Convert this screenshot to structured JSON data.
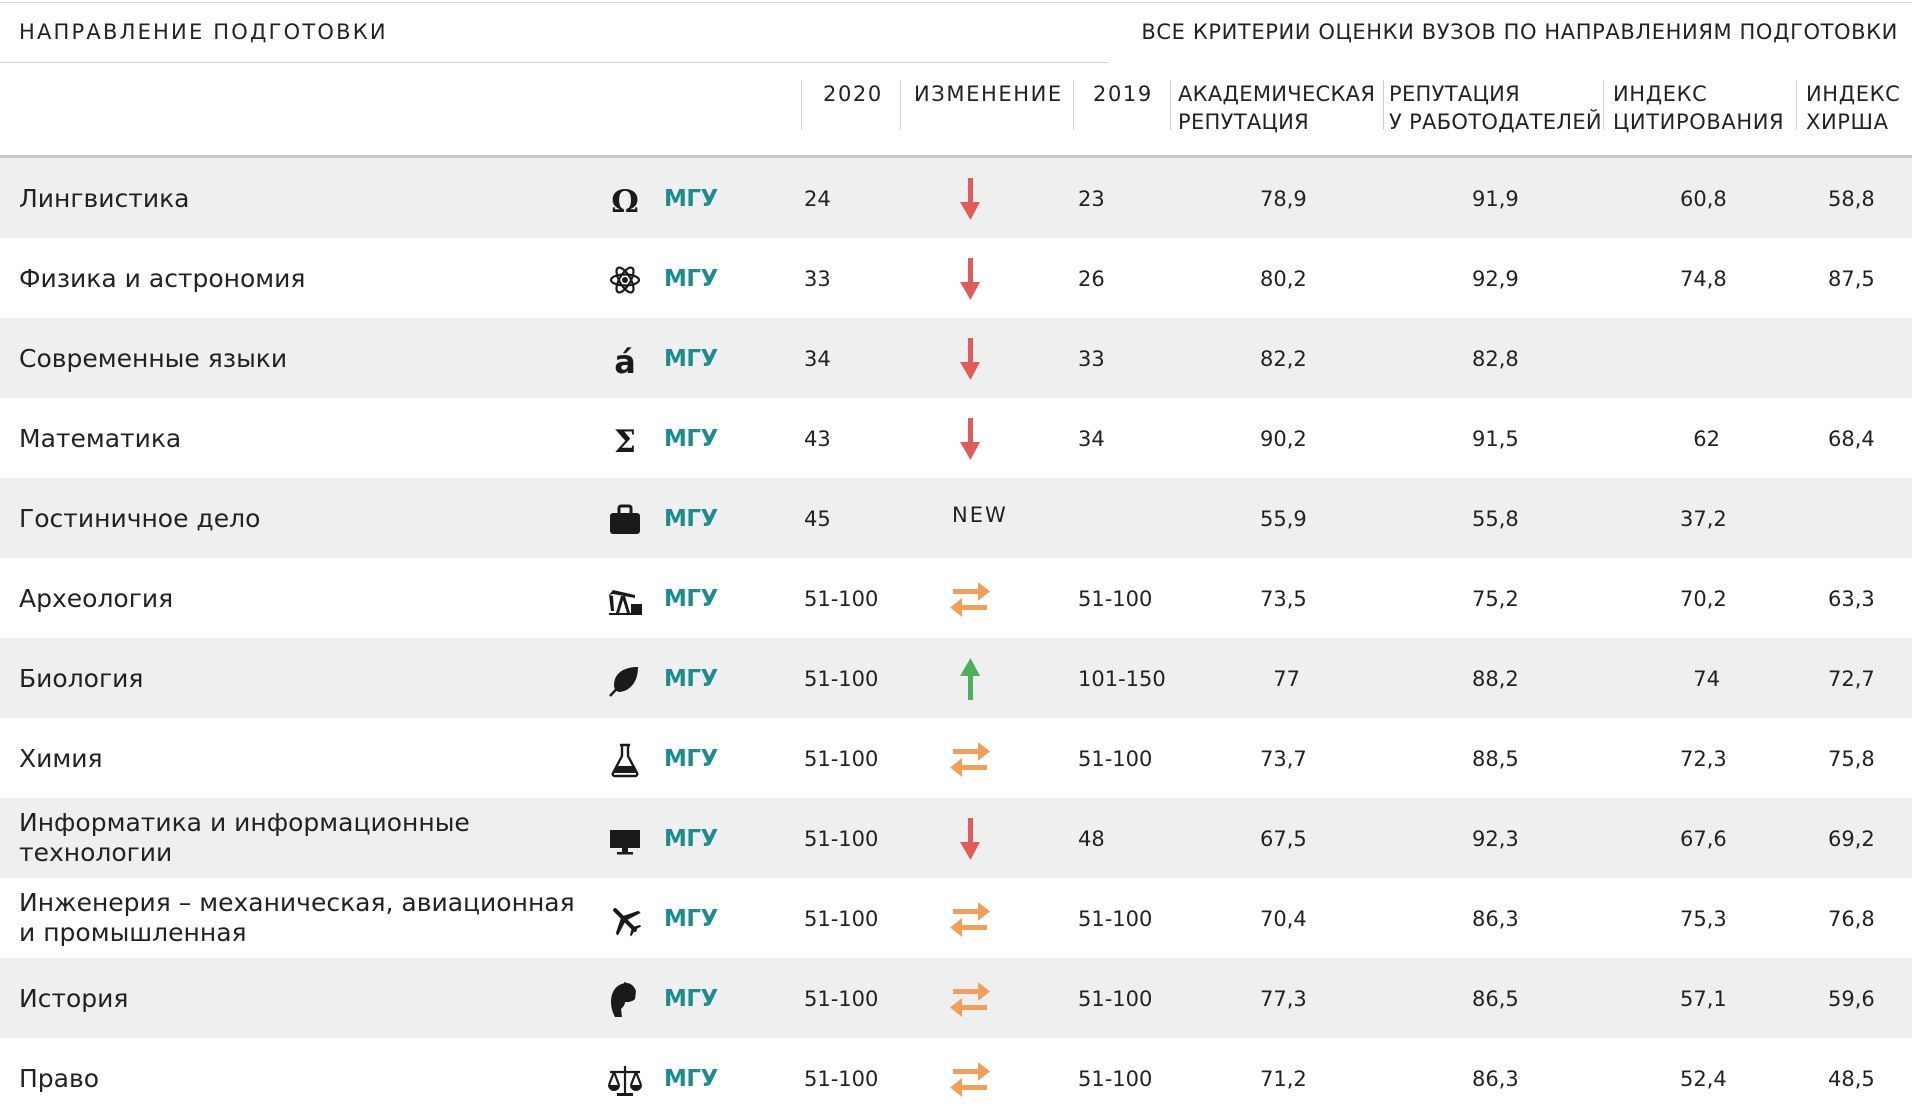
{
  "header": {
    "left_title": "Направление подготовки",
    "right_title": "Все критерии оценки вузов по направлениям подготовки"
  },
  "columns": {
    "y2020": "2020",
    "change": "Изменение",
    "y2019": "2019",
    "academic_1": "Академическая",
    "academic_2": "репутация",
    "employer_1": "Репутация",
    "employer_2": "у работодателей",
    "citation_1": "Индекс",
    "citation_2": "цитирования",
    "hirsch_1": "Индекс",
    "hirsch_2": "Хирша"
  },
  "colors": {
    "down": "#e05b5b",
    "up": "#4fae5e",
    "same": "#f0a05a",
    "university": "#1e8c8e",
    "row_shade": "#efefef"
  },
  "rows": [
    {
      "name": "Лингвистика",
      "icon": "omega-icon",
      "university": "МГУ",
      "y2020": "24",
      "change": "down",
      "y2019": "23",
      "academic": "78,9",
      "employer": "91,9",
      "citation": "60,8",
      "hirsch": "58,8"
    },
    {
      "name": "Физика и астрономия",
      "icon": "atom-icon",
      "university": "МГУ",
      "y2020": "33",
      "change": "down",
      "y2019": "26",
      "academic": "80,2",
      "employer": "92,9",
      "citation": "74,8",
      "hirsch": "87,5"
    },
    {
      "name": "Современные языки",
      "icon": "accent-a-icon",
      "university": "МГУ",
      "y2020": "34",
      "change": "down",
      "y2019": "33",
      "academic": "82,2",
      "employer": "82,8",
      "citation": "",
      "hirsch": ""
    },
    {
      "name": "Математика",
      "icon": "sigma-icon",
      "university": "МГУ",
      "y2020": "43",
      "change": "down",
      "y2019": "34",
      "academic": "90,2",
      "employer": "91,5",
      "citation": "62",
      "hirsch": "68,4"
    },
    {
      "name": "Гостиничное дело",
      "icon": "suitcase-icon",
      "university": "МГУ",
      "y2020": "45",
      "change": "new",
      "change_label": "NEW",
      "y2019": "",
      "academic": "55,9",
      "employer": "55,8",
      "citation": "37,2",
      "hirsch": ""
    },
    {
      "name": "Археология",
      "icon": "oil-pump-icon",
      "university": "МГУ",
      "y2020": "51-100",
      "change": "same",
      "y2019": "51-100",
      "academic": "73,5",
      "employer": "75,2",
      "citation": "70,2",
      "hirsch": "63,3"
    },
    {
      "name": "Биология",
      "icon": "leaf-icon",
      "university": "МГУ",
      "y2020": "51-100",
      "change": "up",
      "y2019": "101-150",
      "academic": "77",
      "employer": "88,2",
      "citation": "74",
      "hirsch": "72,7"
    },
    {
      "name": "Химия",
      "icon": "flask-icon",
      "university": "МГУ",
      "y2020": "51-100",
      "change": "same",
      "y2019": "51-100",
      "academic": "73,7",
      "employer": "88,5",
      "citation": "72,3",
      "hirsch": "75,8"
    },
    {
      "name": "Информатика и информационные технологии",
      "icon": "monitor-icon",
      "university": "МГУ",
      "y2020": "51-100",
      "change": "down",
      "y2019": "48",
      "academic": "67,5",
      "employer": "92,3",
      "citation": "67,6",
      "hirsch": "69,2"
    },
    {
      "name": "Инженерия – механическая, авиационная и промышленная",
      "icon": "airplane-icon",
      "university": "МГУ",
      "y2020": "51-100",
      "change": "same",
      "y2019": "51-100",
      "academic": "70,4",
      "employer": "86,3",
      "citation": "75,3",
      "hirsch": "76,8"
    },
    {
      "name": "История",
      "icon": "helmet-icon",
      "university": "МГУ",
      "y2020": "51-100",
      "change": "same",
      "y2019": "51-100",
      "academic": "77,3",
      "employer": "86,5",
      "citation": "57,1",
      "hirsch": "59,6"
    },
    {
      "name": "Право",
      "icon": "scales-icon",
      "university": "МГУ",
      "y2020": "51-100",
      "change": "same",
      "y2019": "51-100",
      "academic": "71,2",
      "employer": "86,3",
      "citation": "52,4",
      "hirsch": "48,5"
    }
  ]
}
